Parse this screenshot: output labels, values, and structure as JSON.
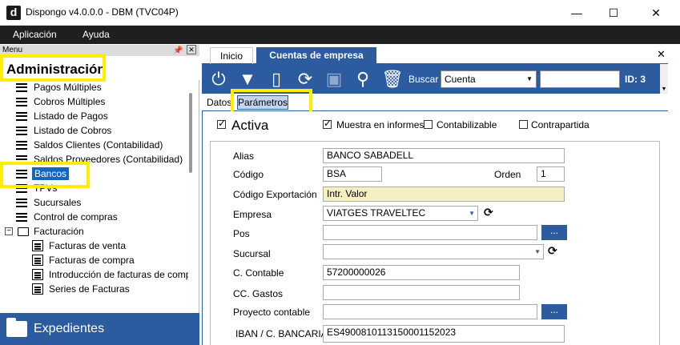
{
  "window": {
    "logo": "d",
    "title": "Dispongo v4.0.0.0 - DBM (TVC04P)",
    "minimize": "—",
    "maximize": "☐",
    "close": "✕"
  },
  "menubar": {
    "items": [
      "Aplicación",
      "Ayuda"
    ]
  },
  "left": {
    "menu_label": "Menu",
    "section_title": "Administración",
    "items": [
      "Pagos Múltiples",
      "Cobros Múltiples",
      "Listado de Pagos",
      "Listado de Cobros",
      "Saldos Clientes (Contabilidad)",
      "Saldos Proveedores (Contabilidad)",
      "Bancos",
      "TPVs",
      "Sucursales",
      "Control de compras",
      "Facturación",
      "Facturas de venta",
      "Facturas de compra",
      "Introducción de facturas de comp",
      "Series de Facturas"
    ],
    "bottom_section": "Expedientes"
  },
  "tabs": [
    "Inicio",
    "Cuentas de empresa"
  ],
  "toolbar": {
    "search_label": "Buscar",
    "search_select": "Cuenta",
    "search_value": "",
    "id_label": "ID: 3"
  },
  "subtabs": [
    "Datos",
    "Parámetros"
  ],
  "form": {
    "activa": "Activa",
    "muestra": "Muestra en informes",
    "contabilizable": "Contabilizable",
    "contrapartida": "Contrapartida",
    "alias_label": "Alias",
    "alias_value": "BANCO SABADELL",
    "codigo_label": "Código",
    "codigo_value": "BSA",
    "orden_label": "Orden",
    "orden_value": "1",
    "codexp_label": "Código Exportación",
    "codexp_value": "Intr. Valor",
    "empresa_label": "Empresa",
    "empresa_value": "VIATGES TRAVELTEC",
    "pos_label": "Pos",
    "sucursal_label": "Sucursal",
    "ccontable_label": "C. Contable",
    "ccontable_value": "57200000026",
    "ccgastos_label": "CC. Gastos",
    "proyecto_label": "Proyecto contable",
    "iban_label": "IBAN / C. BANCARIA",
    "iban_value": "ES4900810113150001152023",
    "dots": "...",
    "refresh": "⟳"
  },
  "colors": {
    "accent": "#2c5ba0",
    "highlight": "#ffee00",
    "selected": "#1565c0"
  }
}
